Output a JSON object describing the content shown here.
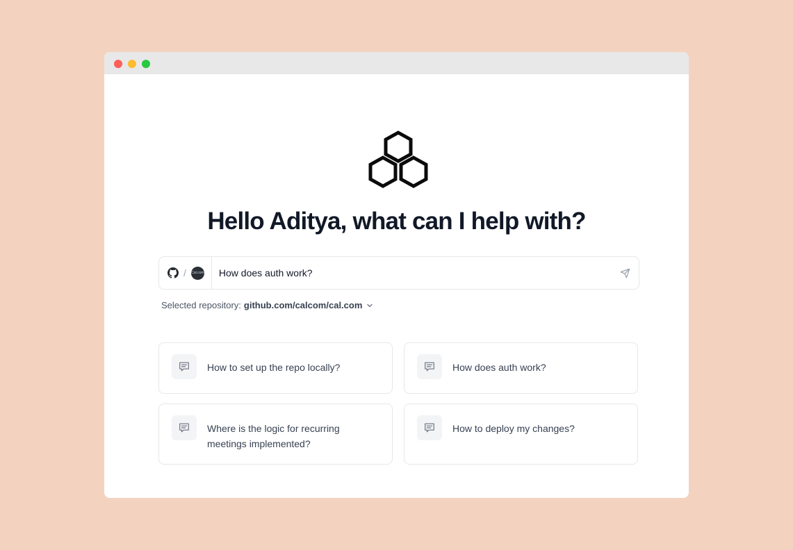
{
  "greeting": "Hello Aditya, what can I help with?",
  "search": {
    "value": "How does auth work?",
    "repo_separator": "/",
    "org_avatar_text": "Cal.com"
  },
  "selected_repo": {
    "label": "Selected repository:",
    "repo": "github.com/calcom/cal.com"
  },
  "suggestions": [
    {
      "text": "How to set up the repo locally?"
    },
    {
      "text": "How does auth work?"
    },
    {
      "text": "Where is the logic for recurring meetings implemented?"
    },
    {
      "text": "How to deploy my changes?"
    }
  ],
  "colors": {
    "background": "#f3d3c0",
    "window_close": "#fe5f57",
    "window_minimize": "#febc2e",
    "window_maximize": "#28c840"
  },
  "icons": {
    "logo": "hexagon-cluster-logo",
    "repo_host": "github-icon",
    "send": "send-icon",
    "suggestion": "chat-bubble-icon",
    "dropdown": "chevron-down-icon"
  }
}
